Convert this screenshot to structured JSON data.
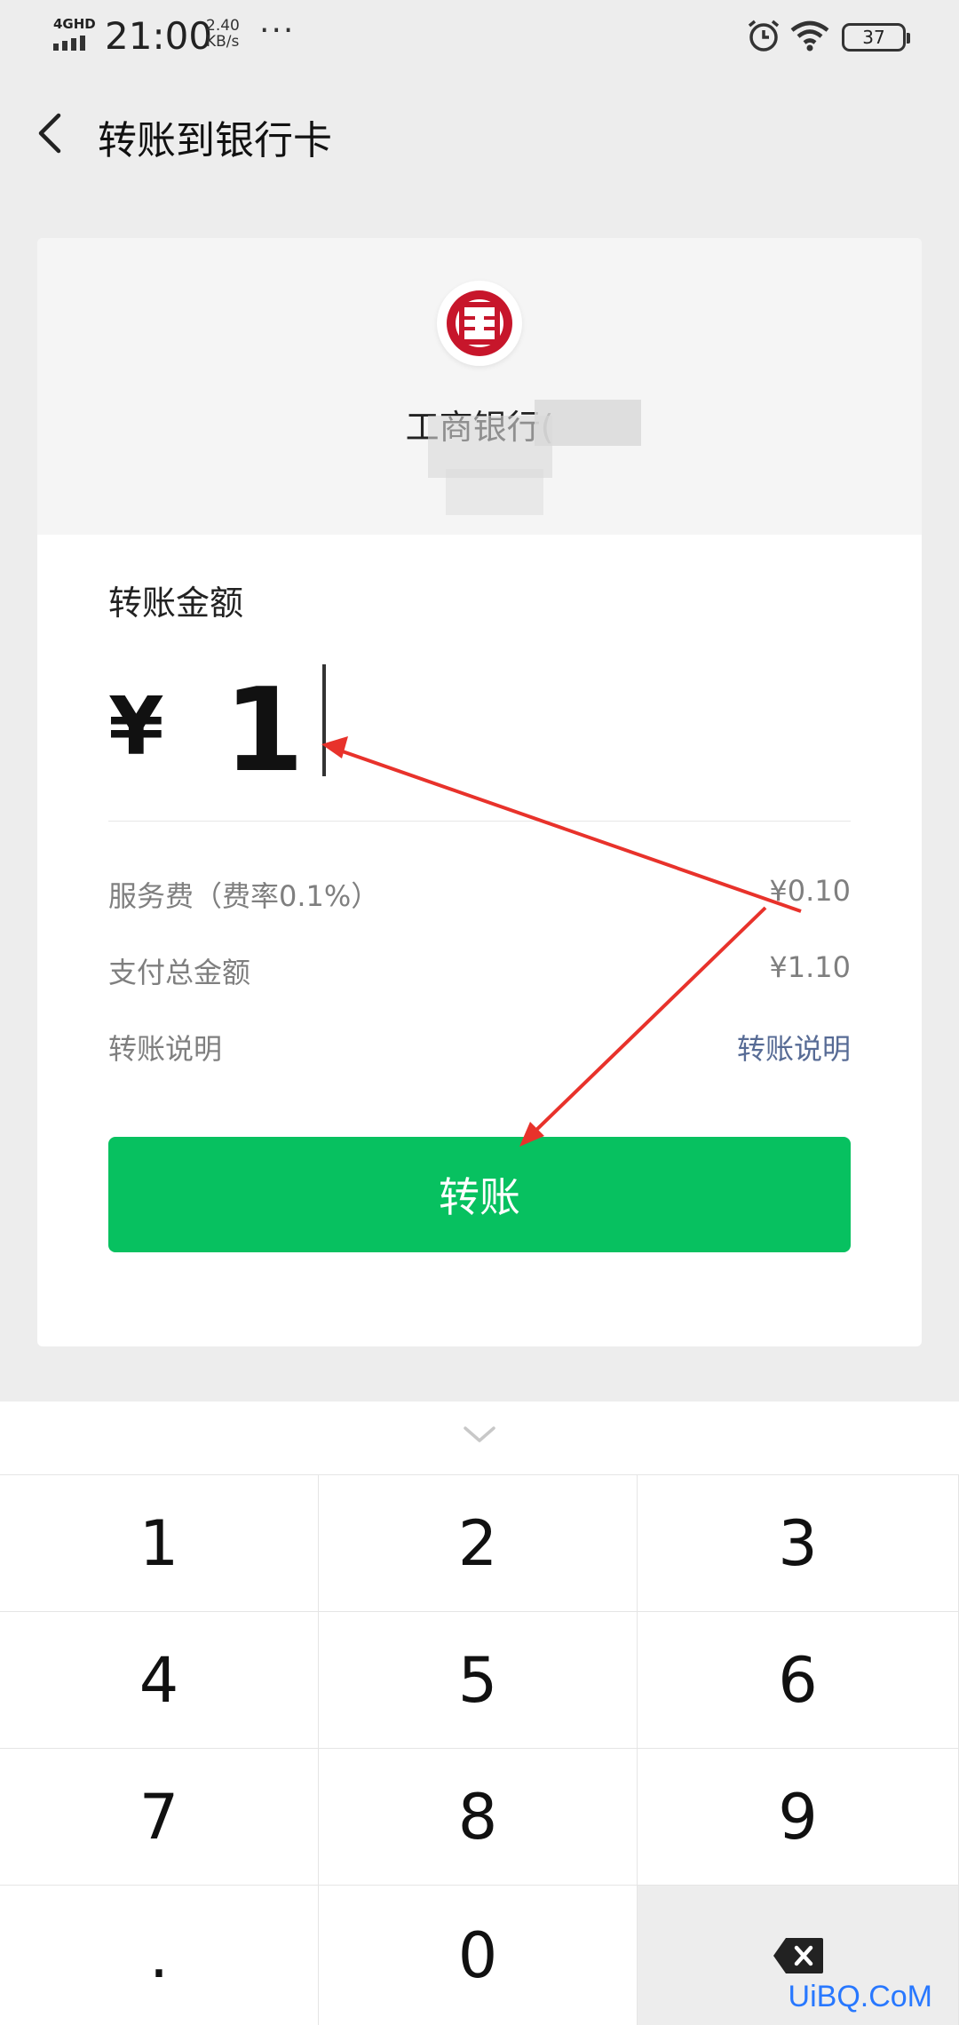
{
  "status_bar": {
    "network": "4GHD",
    "time": "21:00",
    "speed_value": "2.40",
    "speed_unit": "KB/s",
    "more": "···",
    "battery": "37",
    "icons": [
      "alarm-icon",
      "wifi-icon",
      "battery-icon"
    ]
  },
  "nav": {
    "back_icon": "chevron-left-icon",
    "title": "转账到银行卡"
  },
  "bank": {
    "logo_icon": "icbc-logo-icon",
    "name": "工商银行("
  },
  "amount": {
    "label": "转账金额",
    "currency": "¥",
    "value": "1"
  },
  "details": [
    {
      "label": "服务费（费率0.1%）",
      "value": "¥0.10"
    },
    {
      "label": "支付总金额",
      "value": "¥1.10"
    },
    {
      "label": "转账说明",
      "value": "转账说明"
    }
  ],
  "button": {
    "label": "转账"
  },
  "colors": {
    "accent_green": "#07c160",
    "link_blue": "#576b95",
    "annotation_red": "#e8322b"
  },
  "keypad": {
    "collapse_icon": "chevron-down-icon",
    "keys": [
      "1",
      "2",
      "3",
      "4",
      "5",
      "6",
      "7",
      "8",
      "9",
      ".",
      "0"
    ],
    "delete_icon": "backspace-icon"
  },
  "watermark": "UiBQ.CoM"
}
